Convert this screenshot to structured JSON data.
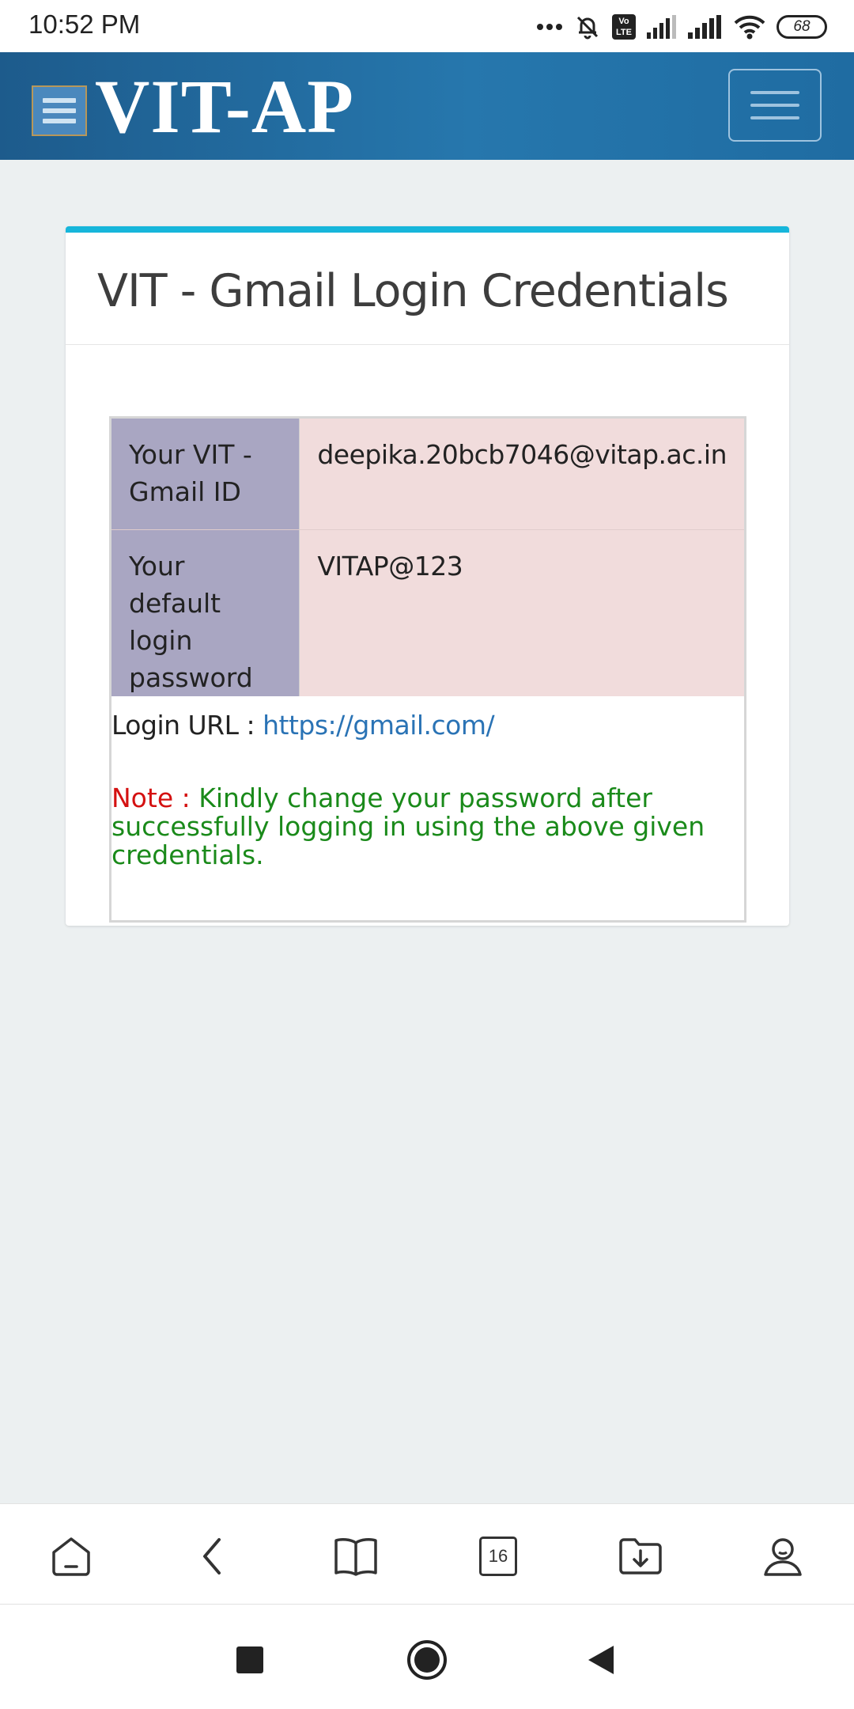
{
  "status_bar": {
    "time": "10:52 PM",
    "battery": "68",
    "volte": "Vo\nLTE",
    "icons": [
      "more-dots-icon",
      "mute-bell-icon",
      "volte-icon",
      "signal-icon",
      "signal-icon",
      "wifi-icon",
      "battery-icon"
    ]
  },
  "header": {
    "brand": "VIT-AP",
    "menu_icon": "hamburger-menu-icon",
    "toggle_icon": "navbar-toggle-icon"
  },
  "card": {
    "accent_color": "#16b6db",
    "title": "VIT - Gmail Login Credentials",
    "rows": [
      {
        "label": "Your VIT - Gmail ID",
        "value": "deepika.20bcb7046@vitap.ac.in"
      },
      {
        "label": "Your default login password",
        "value": "VITAP@123"
      }
    ],
    "login_url_label": "Login URL :",
    "login_url": "https://gmail.com/",
    "note_label": "Note :",
    "note_text": "Kindly change your password after successfully logging in using the above given credentials."
  },
  "browser_bar": {
    "items": [
      "home-icon",
      "back-icon",
      "bookmarks-icon",
      "tabs-icon",
      "downloads-icon",
      "profile-icon"
    ],
    "tabs_count": "16"
  },
  "nav_bar": {
    "items": [
      "recents-icon",
      "home-circle-icon",
      "back-triangle-icon"
    ]
  }
}
